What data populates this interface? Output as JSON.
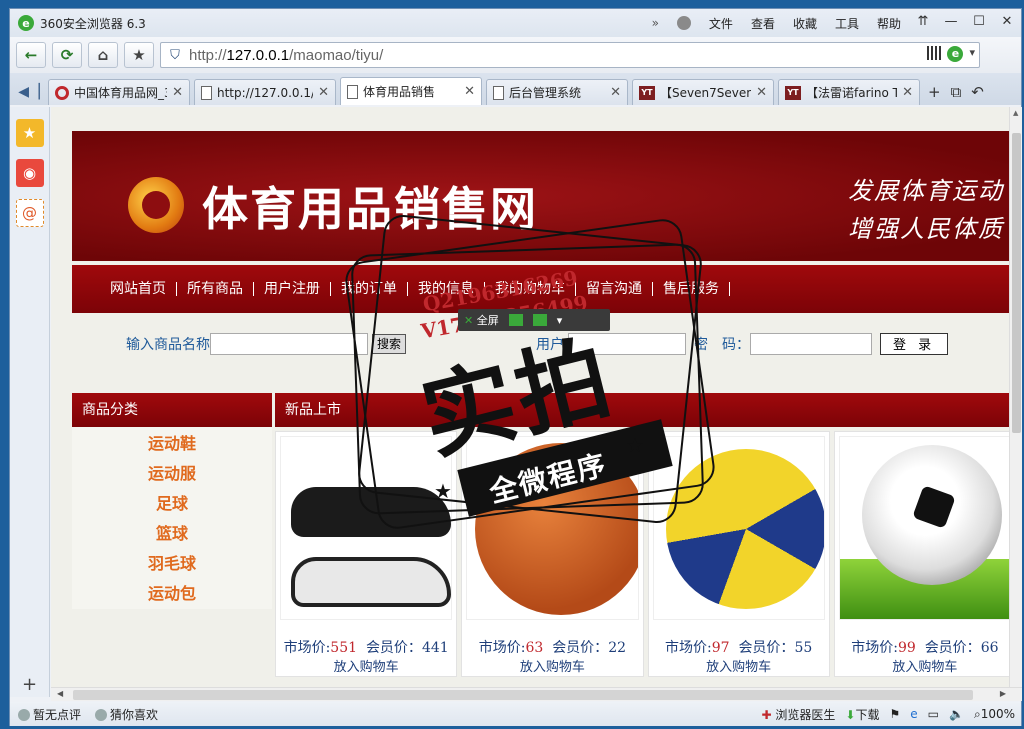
{
  "browser": {
    "title": "360安全浏览器 6.3",
    "menu": [
      "文件",
      "查看",
      "收藏",
      "工具",
      "帮助"
    ],
    "url_prefix": "http://",
    "url_host": "127.0.0.1",
    "url_path": "/maomao/tiyu/",
    "tabs": [
      {
        "label": "中国体育用品网_3",
        "icon": "red-ring-icon",
        "active": false
      },
      {
        "label": "http://127.0.0.1/",
        "icon": "page-icon",
        "active": false
      },
      {
        "label": "体育用品销售",
        "icon": "page-icon",
        "active": true
      },
      {
        "label": "后台管理系统",
        "icon": "page-icon",
        "active": false
      },
      {
        "label": "【Seven7Seven7",
        "icon": "yt-icon",
        "active": false
      },
      {
        "label": "【法雷诺farino T",
        "icon": "yt-icon",
        "active": false
      }
    ],
    "status_left": [
      "暂无点评",
      "猜你喜欢"
    ],
    "status_right": [
      "浏览器医生",
      "下载",
      "100%"
    ]
  },
  "site": {
    "banner_title": "体育用品销售网",
    "slogan1": "发展体育运动",
    "slogan2": "增强人民体质",
    "nav": [
      "网站首页",
      "所有商品",
      "用户注册",
      "我的订单",
      "我的信息",
      "我的购物车",
      "留言沟通",
      "售后服务"
    ],
    "search_label": "输入商品名称",
    "search_button": "搜索",
    "user_label": "用户",
    "password_label": "密　码：",
    "login_button": "登 录",
    "category_title": "商品分类",
    "categories": [
      "运动鞋",
      "运动服",
      "足球",
      "篮球",
      "羽毛球",
      "运动包"
    ],
    "new_title": "新品上市",
    "market_label": "市场价:",
    "member_label": "会员价：",
    "add_cart": "放入购物车",
    "products": [
      {
        "image": "sneaker-image",
        "market": "551",
        "member": "441"
      },
      {
        "image": "basketball-image",
        "market": "63",
        "member": "22"
      },
      {
        "image": "volleyball-image",
        "market": "97",
        "member": "55"
      },
      {
        "image": "soccer-ball-image",
        "market": "99",
        "member": "66"
      }
    ]
  },
  "overlay": {
    "line1": "Q2196316269",
    "line2": "V17060256499",
    "big": "实拍",
    "ribbon": "全微程序",
    "mini_toolbar_label": "全屏"
  },
  "colors": {
    "brand_red": "#8d0d10",
    "category_orange": "#e06a1e",
    "price_red": "#c0282d",
    "link_blue": "#1f3f7a"
  }
}
